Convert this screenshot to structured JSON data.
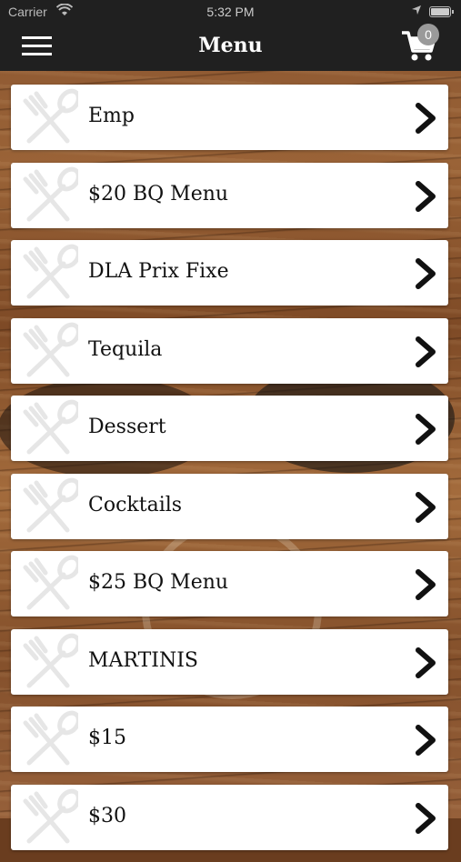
{
  "status_bar": {
    "carrier": "Carrier",
    "time": "5:32 PM"
  },
  "nav": {
    "title": "Menu",
    "cart_count": "0",
    "menu_icon": "hamburger-icon",
    "cart_icon": "cart-icon"
  },
  "menu": {
    "items": [
      {
        "label": "Emp"
      },
      {
        "label": "$20 BQ Menu"
      },
      {
        "label": "DLA Prix Fixe"
      },
      {
        "label": "Tequila"
      },
      {
        "label": "Dessert"
      },
      {
        "label": "Cocktails"
      },
      {
        "label": "$25 BQ Menu"
      },
      {
        "label": "MARTINIS"
      },
      {
        "label": "$15"
      },
      {
        "label": "$30"
      }
    ],
    "item_icon": "fork-spoon-icon",
    "chevron_icon": "chevron-right-icon"
  },
  "colors": {
    "header_bg": "#202020",
    "card_bg": "#ffffff",
    "text": "#111111",
    "badge": "#9a9a9a"
  }
}
